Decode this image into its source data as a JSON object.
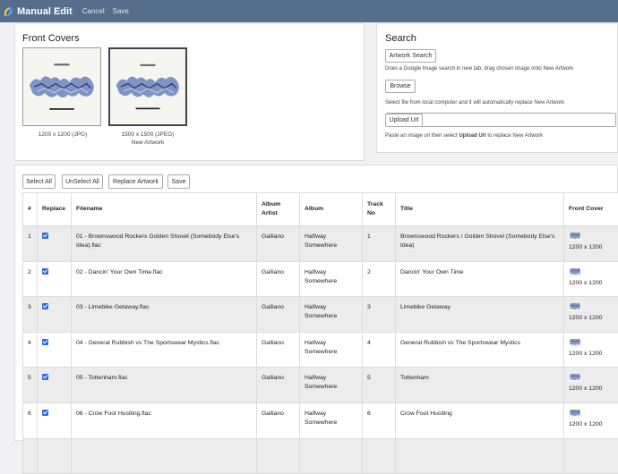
{
  "header": {
    "app_title": "Manual Edit",
    "cancel_label": "Cancel",
    "save_label": "Save"
  },
  "covers": {
    "title": "Front Covers",
    "items": [
      {
        "caption": "1200 x 1200 (JPG)",
        "note": ""
      },
      {
        "caption": "1500 x 1500 (JPEG)",
        "note": "New Artwork"
      }
    ]
  },
  "search": {
    "title": "Search",
    "artwork_search_label": "Artwork Search",
    "artwork_search_hint": "Does a Google Image search in new tab, drag chosen image onto New Artwork",
    "browse_label": "Browse",
    "browse_hint": "Select file from local computer and it will automatically replace New Artwork",
    "upload_url_label": "Upload Url",
    "upload_hint_pre": "Paste an image url then select ",
    "upload_hint_bold": "Upload Url",
    "upload_hint_post": " to replace New Artwork",
    "url_value": ""
  },
  "toolbar": {
    "select_all": "Select All",
    "unselect_all": "UnSelect All",
    "replace_artwork": "Replace Artwork",
    "save": "Save"
  },
  "table": {
    "headers": [
      "#",
      "Replace",
      "Filename",
      "Album Artist",
      "Album",
      "Track No",
      "Title",
      "Front Cover"
    ],
    "rows": [
      {
        "num": "1",
        "checked": true,
        "filename": "01 - Brownswood Rockers Golden Shovel (Somebody Else's Idea).flac",
        "artist": "Galliano",
        "album": "Halfway Somewhere",
        "track": "1",
        "title": "Brownswood Rockers / Golden Shovel (Somebody Else's Idea)",
        "cover": "1200 x 1200"
      },
      {
        "num": "2",
        "checked": true,
        "filename": "02 - Dancin' Your Own Time.flac",
        "artist": "Galliano",
        "album": "Halfway Somewhere",
        "track": "2",
        "title": "Dancin' Your Own Time",
        "cover": "1200 x 1200"
      },
      {
        "num": "3",
        "checked": true,
        "filename": "03 - Limebike Getaway.flac",
        "artist": "Galliano",
        "album": "Halfway Somewhere",
        "track": "3",
        "title": "Limebike Getaway",
        "cover": "1200 x 1200"
      },
      {
        "num": "4",
        "checked": true,
        "filename": "04 - General Rubbish vs The Sportswear Mystics.flac",
        "artist": "Galliano",
        "album": "Halfway Somewhere",
        "track": "4",
        "title": "General Rubbish vs The Sportswear Mystics",
        "cover": "1200 x 1200"
      },
      {
        "num": "5",
        "checked": true,
        "filename": "05 - Tottenham.flac",
        "artist": "Galliano",
        "album": "Halfway Somewhere",
        "track": "5",
        "title": "Tottenham",
        "cover": "1200 x 1200"
      },
      {
        "num": "6",
        "checked": true,
        "filename": "06 - Crow Foot Hustling.flac",
        "artist": "Galliano",
        "album": "Halfway Somewhere",
        "track": "6",
        "title": "Crow Foot Hustling",
        "cover": "1200 x 1200"
      },
      {
        "num": "",
        "checked": false,
        "filename": "",
        "artist": "",
        "album": "",
        "track": "",
        "title": "",
        "cover": ""
      }
    ]
  },
  "colors": {
    "topbar": "#546e8c",
    "checkbox": "#2d6be0",
    "artwork": "#7f93c4"
  }
}
